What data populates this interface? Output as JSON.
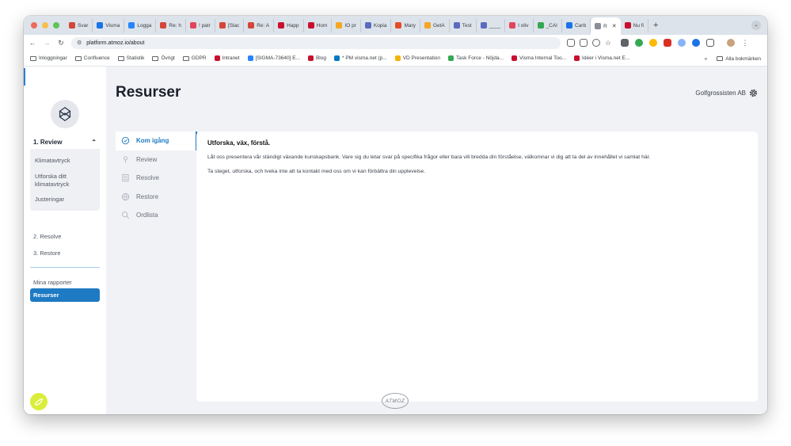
{
  "browser": {
    "tabs": [
      {
        "label": "Svar",
        "color": "#d44638"
      },
      {
        "label": "Visma",
        "color": "#1a73e8"
      },
      {
        "label": "Logga",
        "color": "#2684ff"
      },
      {
        "label": "Re: h",
        "color": "#d44638"
      },
      {
        "label": "! patr",
        "color": "#e2445c"
      },
      {
        "label": "[Slac",
        "color": "#d44638"
      },
      {
        "label": "Re: A",
        "color": "#d44638"
      },
      {
        "label": "Happ",
        "color": "#c8102e"
      },
      {
        "label": "Hom",
        "color": "#c8102e"
      },
      {
        "label": "IO pr",
        "color": "#f5a623"
      },
      {
        "label": "Kopia",
        "color": "#5c6bc0"
      },
      {
        "label": "Mary",
        "color": "#e44d26"
      },
      {
        "label": "GetA",
        "color": "#f5a623"
      },
      {
        "label": "Test",
        "color": "#5c6bc0"
      },
      {
        "label": "____",
        "color": "#5c6bc0"
      },
      {
        "label": "I oliv",
        "color": "#e2445c"
      },
      {
        "label": "_CAI",
        "color": "#34a853"
      },
      {
        "label": "Carb",
        "color": "#1a73e8"
      },
      {
        "label": "R",
        "color": "#8a8f99"
      },
      {
        "label": "Nu fi",
        "color": "#c8102e"
      }
    ],
    "active_tab_index": 18,
    "new_tab": "+",
    "url": "platform.atmoz.io/about",
    "bookmarks": [
      {
        "label": "Inloggningar",
        "type": "folder"
      },
      {
        "label": "Confluence",
        "type": "folder"
      },
      {
        "label": "Statistik",
        "type": "folder"
      },
      {
        "label": "Övrigt",
        "type": "folder"
      },
      {
        "label": "GDPR",
        "type": "folder"
      },
      {
        "label": "Intranet",
        "type": "link",
        "color": "#c8102e"
      },
      {
        "label": "[SIGMA-73640] E...",
        "type": "link",
        "color": "#2684ff"
      },
      {
        "label": "Blog",
        "type": "link",
        "color": "#c8102e"
      },
      {
        "label": "* PM visma.net (p...",
        "type": "link",
        "color": "#0079bf"
      },
      {
        "label": "VD Presentation",
        "type": "link",
        "color": "#f4b400"
      },
      {
        "label": "Task Force - Nöjda...",
        "type": "link",
        "color": "#34a853"
      },
      {
        "label": "Visma Internal Too...",
        "type": "link",
        "color": "#c8102e"
      },
      {
        "label": "Idéer i Visma.net E...",
        "type": "link",
        "color": "#c8102e"
      }
    ],
    "bookmarks_more": "»",
    "all_bookmarks": "Alla bokmärken"
  },
  "sidebar": {
    "review_label": "1. Review",
    "review_items": [
      "Klimatavtryck",
      "Utforska ditt klimatavtryck",
      "Justeringar"
    ],
    "resolve_label": "2. Resolve",
    "restore_label": "3. Restore",
    "reports_label": "Mina rapporter",
    "resources_label": "Resurser"
  },
  "header": {
    "title": "Resurser",
    "company": "Golfgrossisten AB"
  },
  "resources_nav": [
    {
      "label": "Kom igång",
      "icon": "check-circle-icon",
      "active": true
    },
    {
      "label": "Review",
      "icon": "pin-icon",
      "active": false
    },
    {
      "label": "Resolve",
      "icon": "list-icon",
      "active": false
    },
    {
      "label": "Restore",
      "icon": "globe-icon",
      "active": false
    },
    {
      "label": "Ordlista",
      "icon": "search-icon",
      "active": false
    }
  ],
  "content": {
    "heading": "Utforska, väx, förstå.",
    "p1": "Låt oss presentera vår ständigt växande kunskapsbank. Vare sig du letar svar på specifika frågor eller bara vill bredda din förståelse, välkomnar vi dig att ta del av innehållet vi samlat här.",
    "p2": "Ta steget, utforska, och tveka inte att ta kontakt med oss om vi kan förbättra din upplevelse."
  },
  "footer": {
    "logo_text": "ATMOZ"
  },
  "colors": {
    "accent": "#1e7ac2",
    "badge": "#d9ed3a"
  }
}
